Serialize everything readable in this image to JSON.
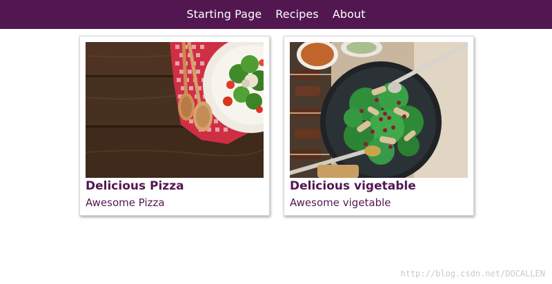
{
  "nav": {
    "items": [
      {
        "label": "Starting Page"
      },
      {
        "label": "Recipes"
      },
      {
        "label": "About"
      }
    ]
  },
  "cards": [
    {
      "title": "Delicious Pizza",
      "subtitle": "Awesome Pizza",
      "image": "salad-plate-on-wooden-table"
    },
    {
      "title": "Delicious vigetable",
      "subtitle": "Awesome vigetable",
      "image": "salad-bowl-with-grilled-chicken"
    }
  ],
  "watermark": "http://blog.csdn.net/DOCALLEN",
  "colors": {
    "nav_bg": "#521751",
    "nav_text": "#ffffff",
    "accent": "#521751"
  }
}
